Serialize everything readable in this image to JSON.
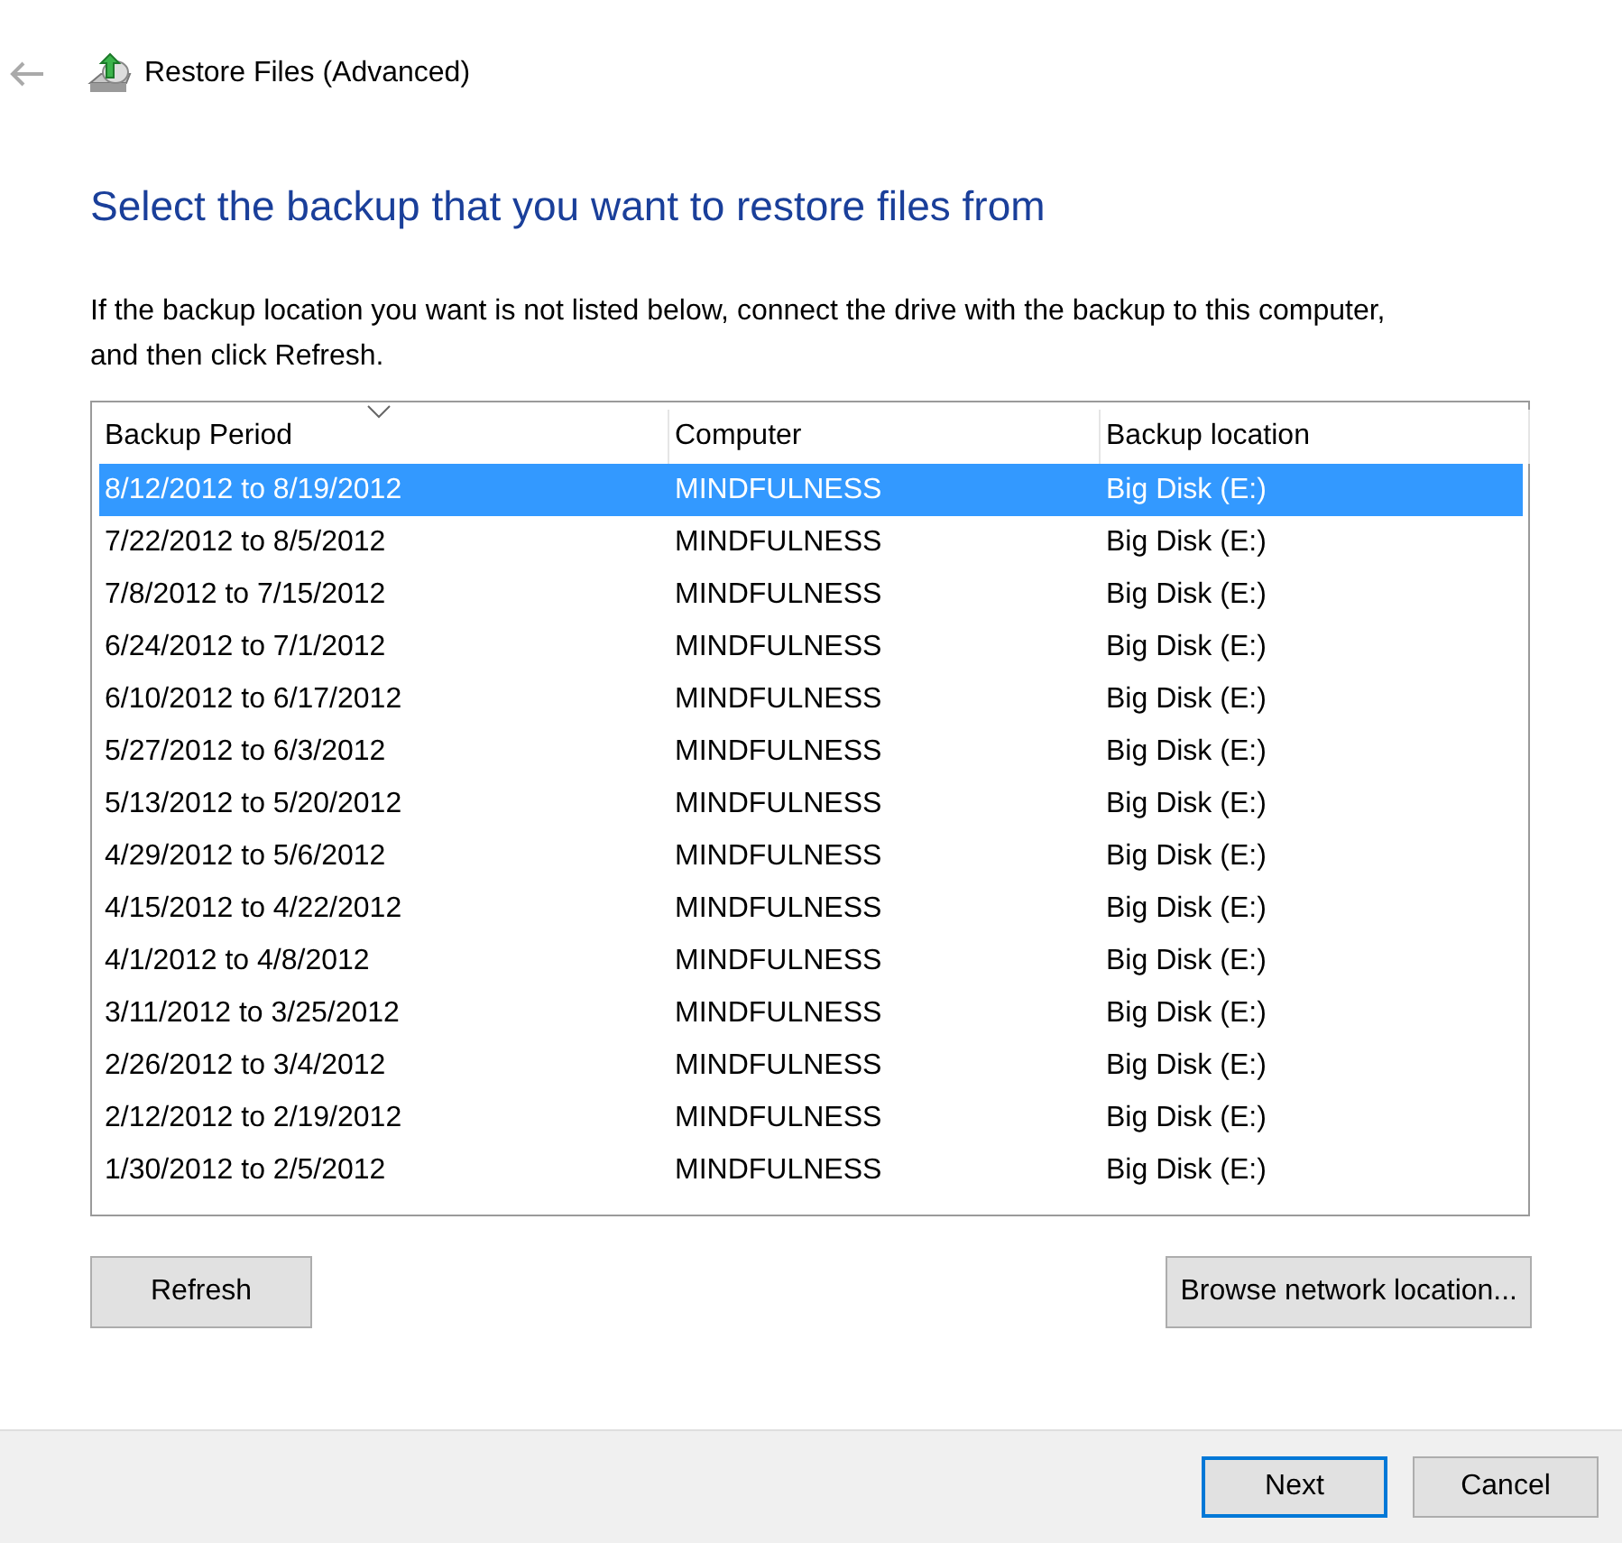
{
  "window": {
    "title": "Restore Files (Advanced)"
  },
  "heading": "Select the backup that you want to restore files from",
  "description": "If the backup location you want is not listed below, connect the drive with the backup to this computer, and then click Refresh.",
  "table": {
    "columns": [
      {
        "label": "Backup Period",
        "sorted": true
      },
      {
        "label": "Computer",
        "sorted": false
      },
      {
        "label": "Backup location",
        "sorted": false
      }
    ],
    "rows": [
      {
        "cells": [
          "8/12/2012 to 8/19/2012",
          "MINDFULNESS",
          "Big Disk (E:)"
        ],
        "selected": true
      },
      {
        "cells": [
          "7/22/2012 to 8/5/2012",
          "MINDFULNESS",
          "Big Disk (E:)"
        ],
        "selected": false
      },
      {
        "cells": [
          "7/8/2012 to 7/15/2012",
          "MINDFULNESS",
          "Big Disk (E:)"
        ],
        "selected": false
      },
      {
        "cells": [
          "6/24/2012 to 7/1/2012",
          "MINDFULNESS",
          "Big Disk (E:)"
        ],
        "selected": false
      },
      {
        "cells": [
          "6/10/2012 to 6/17/2012",
          "MINDFULNESS",
          "Big Disk (E:)"
        ],
        "selected": false
      },
      {
        "cells": [
          "5/27/2012 to 6/3/2012",
          "MINDFULNESS",
          "Big Disk (E:)"
        ],
        "selected": false
      },
      {
        "cells": [
          "5/13/2012 to 5/20/2012",
          "MINDFULNESS",
          "Big Disk (E:)"
        ],
        "selected": false
      },
      {
        "cells": [
          "4/29/2012 to 5/6/2012",
          "MINDFULNESS",
          "Big Disk (E:)"
        ],
        "selected": false
      },
      {
        "cells": [
          "4/15/2012 to 4/22/2012",
          "MINDFULNESS",
          "Big Disk (E:)"
        ],
        "selected": false
      },
      {
        "cells": [
          "4/1/2012 to 4/8/2012",
          "MINDFULNESS",
          "Big Disk (E:)"
        ],
        "selected": false
      },
      {
        "cells": [
          "3/11/2012 to 3/25/2012",
          "MINDFULNESS",
          "Big Disk (E:)"
        ],
        "selected": false
      },
      {
        "cells": [
          "2/26/2012 to 3/4/2012",
          "MINDFULNESS",
          "Big Disk (E:)"
        ],
        "selected": false
      },
      {
        "cells": [
          "2/12/2012 to 2/19/2012",
          "MINDFULNESS",
          "Big Disk (E:)"
        ],
        "selected": false
      },
      {
        "cells": [
          "1/30/2012 to 2/5/2012",
          "MINDFULNESS",
          "Big Disk (E:)"
        ],
        "selected": false
      }
    ]
  },
  "actions": [
    "Refresh",
    "Browse network location..."
  ],
  "footer_buttons": [
    {
      "label": "Next",
      "default": true
    },
    {
      "label": "Cancel",
      "default": false
    }
  ]
}
